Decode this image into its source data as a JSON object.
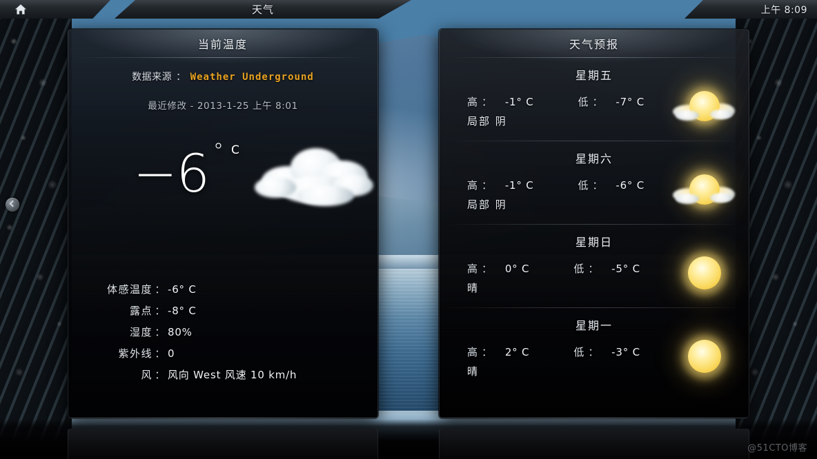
{
  "topbar": {
    "home_icon": "home-icon",
    "title": "天气",
    "clock": "上午 8:09"
  },
  "current_panel": {
    "title": "当前温度",
    "source_label": "数据来源",
    "colon": "：",
    "source_value": "Weather Underground",
    "updated": "最近修改 - 2013-1-25 上午 8:01",
    "temperature": "−6",
    "degree": "°",
    "unit": "C",
    "icon": "cloud-icon",
    "details": [
      {
        "label": "体感温度",
        "colon": "：",
        "value": "-6° C"
      },
      {
        "label": "露点",
        "colon": "：",
        "value": "-8° C"
      },
      {
        "label": "湿度",
        "colon": "：",
        "value": "80%"
      },
      {
        "label": "紫外线",
        "colon": "：",
        "value": "0"
      },
      {
        "label": "风",
        "colon": "：",
        "value": "风向 West 风速 10 km/h"
      }
    ]
  },
  "forecast_panel": {
    "title": "天气预报",
    "hi_label": "高",
    "lo_label": "低",
    "colon": "：",
    "days": [
      {
        "day": "星期五",
        "hi": "-1° C",
        "lo": "-7° C",
        "condition": "局部 阴",
        "icon": "sun-behind-cloud-icon"
      },
      {
        "day": "星期六",
        "hi": "-1° C",
        "lo": "-6° C",
        "condition": "局部 阴",
        "icon": "sun-behind-cloud-icon"
      },
      {
        "day": "星期日",
        "hi": "0° C",
        "lo": "-5° C",
        "condition": "晴",
        "icon": "sun-icon"
      },
      {
        "day": "星期一",
        "hi": "2° C",
        "lo": "-3° C",
        "condition": "晴",
        "icon": "sun-icon"
      }
    ]
  },
  "watermark": "@51CTO博客",
  "colors": {
    "accent_source": "#e8a321",
    "panel_bg": "#050608",
    "topbar_bg": "#1b2025",
    "text_primary": "#e9eef3",
    "text_secondary": "#b3bcc4",
    "sun": "#fada62"
  }
}
